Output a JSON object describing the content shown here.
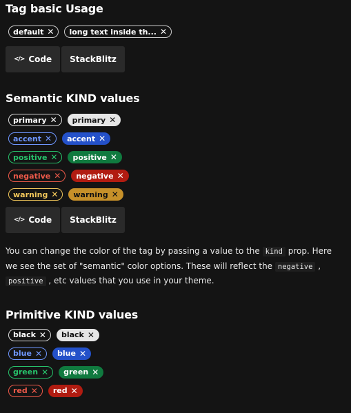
{
  "basic": {
    "title": "Tag basic Usage",
    "tags": [
      {
        "label": "default"
      },
      {
        "label": "long text inside th..."
      }
    ]
  },
  "buttons": {
    "code": "Code",
    "stackblitz": "StackBlitz",
    "code_icon": "code-icon"
  },
  "semantic": {
    "title": "Semantic KIND values",
    "rows": [
      {
        "outline": "primary",
        "solid": "primary",
        "color": "#dcdcdc",
        "solid_bg": "#e6e6e6",
        "solid_fg": "#111111"
      },
      {
        "outline": "accent",
        "solid": "accent",
        "color": "#6f97ff",
        "solid_bg": "#2451c9",
        "solid_fg": "#ffffff"
      },
      {
        "outline": "positive",
        "solid": "positive",
        "color": "#27c26b",
        "solid_bg": "#107a3f",
        "solid_fg": "#ffffff"
      },
      {
        "outline": "negative",
        "solid": "negative",
        "color": "#ef5a4a",
        "solid_bg": "#b11c11",
        "solid_fg": "#ffffff"
      },
      {
        "outline": "warning",
        "solid": "warning",
        "color": "#f1c65a",
        "solid_bg": "#c69029",
        "solid_fg": "#111111"
      }
    ]
  },
  "description": {
    "part1": "You can change the color of the tag by passing a value to the ",
    "code1": "kind",
    "part2": " prop. Here we see the set of \"semantic\" color options. These will reflect the ",
    "code2": "negative",
    "part3": " , ",
    "code3": "positive",
    "part4": " , etc values that you use in your theme."
  },
  "primitive": {
    "title": "Primitive KIND values",
    "rows": [
      {
        "outline": "black",
        "solid": "black",
        "color": "#dcdcdc",
        "solid_bg": "#e6e6e6",
        "solid_fg": "#111111"
      },
      {
        "outline": "blue",
        "solid": "blue",
        "color": "#6f97ff",
        "solid_bg": "#2451c9",
        "solid_fg": "#ffffff"
      },
      {
        "outline": "green",
        "solid": "green",
        "color": "#27c26b",
        "solid_bg": "#107a3f",
        "solid_fg": "#ffffff"
      },
      {
        "outline": "red",
        "solid": "red",
        "color": "#ef5a4a",
        "solid_bg": "#b11c11",
        "solid_fg": "#ffffff"
      }
    ]
  },
  "close_glyph": "✕"
}
